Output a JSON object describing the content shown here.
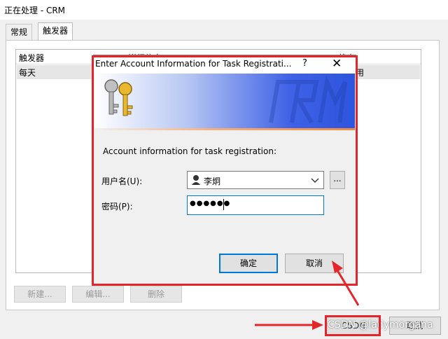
{
  "window": {
    "title": "正在处理 - CRM"
  },
  "tabs": [
    {
      "label": "常规"
    },
    {
      "label": "触发器"
    }
  ],
  "trigger_list": {
    "columns": [
      "触发器",
      "详细信息",
      "状态"
    ],
    "rows": [
      {
        "trigger": "每天",
        "status": "已启用"
      }
    ]
  },
  "list_buttons": {
    "new": "新建...",
    "edit": "编辑...",
    "delete": "删除"
  },
  "bottom_buttons": {
    "ok": "CSDN",
    "cancel": "取消"
  },
  "watermark": "CSDN @ladymorgana",
  "dialog": {
    "title": "Enter Account Information for Task Registrati...",
    "help": "?",
    "close": "✕",
    "prompt": "Account information for task registration:",
    "username_label": "用户名(U):",
    "username_value": "李炯",
    "browse": "...",
    "password_label": "密码(P):",
    "password_value": "●●●●●●",
    "ok": "确定",
    "cancel": "取消"
  },
  "colors": {
    "annotation": "#e3262a",
    "accent": "#0078d7"
  }
}
